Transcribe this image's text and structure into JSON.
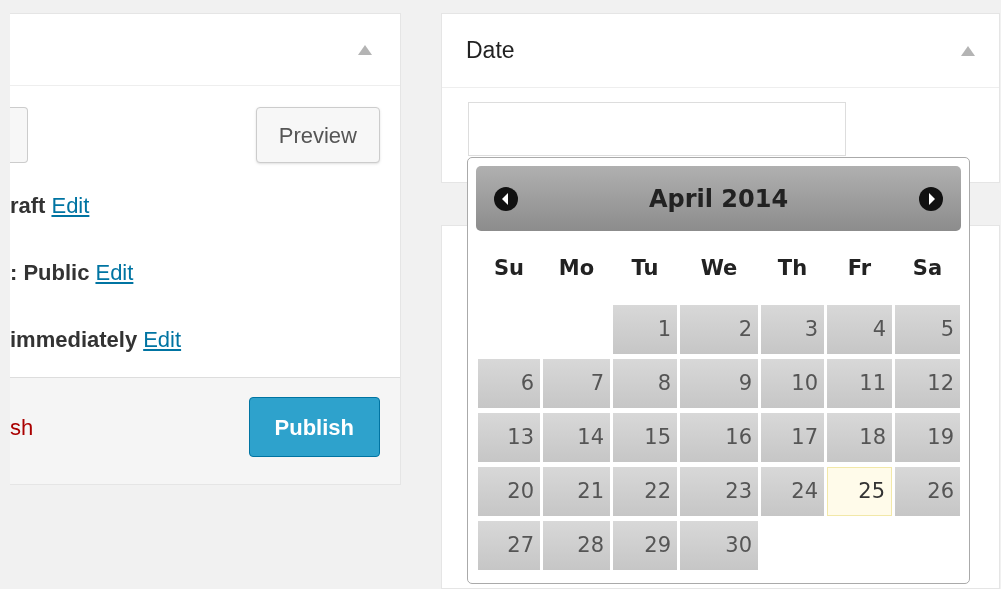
{
  "publish_panel": {
    "buttons": [
      {
        "label": "Preview"
      }
    ],
    "rows": [
      {
        "label": "raft",
        "link": "Edit"
      },
      {
        "label": ": Public",
        "link": "Edit"
      },
      {
        "label": "immediately",
        "link": "Edit"
      }
    ],
    "delete_link": "sh",
    "publish_button": "Publish"
  },
  "date_panel": {
    "title": "Date"
  },
  "calendar": {
    "title": "April 2014",
    "weekdays": [
      "Su",
      "Mo",
      "Tu",
      "We",
      "Th",
      "Fr",
      "Sa"
    ],
    "days": [
      {
        "kind": "blank"
      },
      {
        "kind": "blank"
      },
      {
        "kind": "day",
        "label": "1",
        "today": false
      },
      {
        "kind": "day",
        "label": "2",
        "today": false
      },
      {
        "kind": "day",
        "label": "3",
        "today": false
      },
      {
        "kind": "day",
        "label": "4",
        "today": false
      },
      {
        "kind": "day",
        "label": "5",
        "today": false
      },
      {
        "kind": "day",
        "label": "6",
        "today": false
      },
      {
        "kind": "day",
        "label": "7",
        "today": false
      },
      {
        "kind": "day",
        "label": "8",
        "today": false
      },
      {
        "kind": "day",
        "label": "9",
        "today": false
      },
      {
        "kind": "day",
        "label": "10",
        "today": false
      },
      {
        "kind": "day",
        "label": "11",
        "today": false
      },
      {
        "kind": "day",
        "label": "12",
        "today": false
      },
      {
        "kind": "day",
        "label": "13",
        "today": false
      },
      {
        "kind": "day",
        "label": "14",
        "today": false
      },
      {
        "kind": "day",
        "label": "15",
        "today": false
      },
      {
        "kind": "day",
        "label": "16",
        "today": false
      },
      {
        "kind": "day",
        "label": "17",
        "today": false
      },
      {
        "kind": "day",
        "label": "18",
        "today": false
      },
      {
        "kind": "day",
        "label": "19",
        "today": false
      },
      {
        "kind": "day",
        "label": "20",
        "today": false
      },
      {
        "kind": "day",
        "label": "21",
        "today": false
      },
      {
        "kind": "day",
        "label": "22",
        "today": false
      },
      {
        "kind": "day",
        "label": "23",
        "today": false
      },
      {
        "kind": "day",
        "label": "24",
        "today": false
      },
      {
        "kind": "day",
        "label": "25",
        "today": true
      },
      {
        "kind": "day",
        "label": "26",
        "today": false
      },
      {
        "kind": "day",
        "label": "27",
        "today": false
      },
      {
        "kind": "day",
        "label": "28",
        "today": false
      },
      {
        "kind": "day",
        "label": "29",
        "today": false
      },
      {
        "kind": "day",
        "label": "30",
        "today": false
      }
    ]
  }
}
